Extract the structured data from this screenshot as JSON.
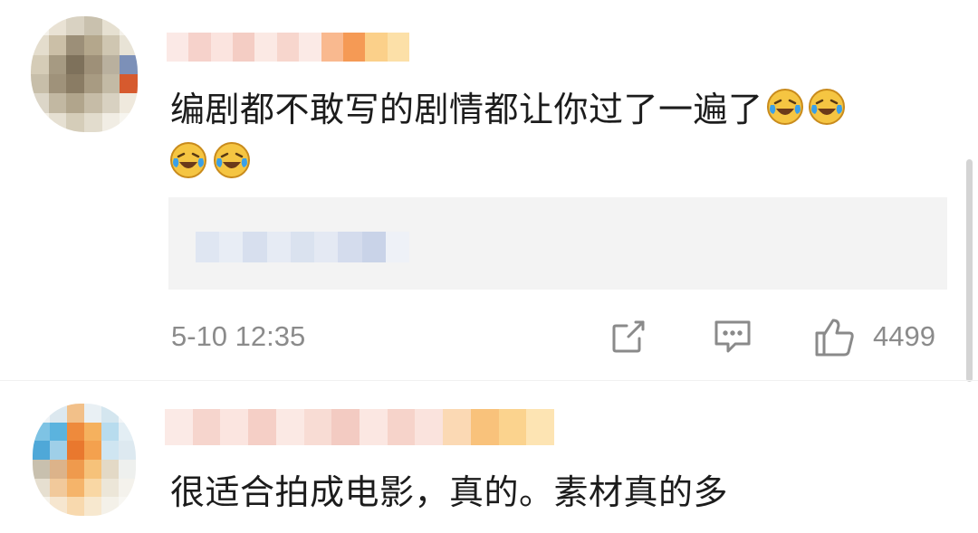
{
  "comments": [
    {
      "text_line1": "编剧都不敢写的剧情都让你过了一遍了",
      "emoji_name": "laughing-crying-emoji",
      "time": "5-10 12:35",
      "like_count": "4499"
    },
    {
      "text": "很适合拍成电影，真的。素材真的多"
    }
  ],
  "icons": {
    "share": "share-icon",
    "comment": "comment-icon",
    "like": "thumbs-up-icon"
  },
  "colors": {
    "meta_gray": "#8b8b8b",
    "quote_background": "#f3f3f3",
    "emoji_yellow": "#f5c542",
    "emoji_tear_blue": "#3aa0e8"
  }
}
